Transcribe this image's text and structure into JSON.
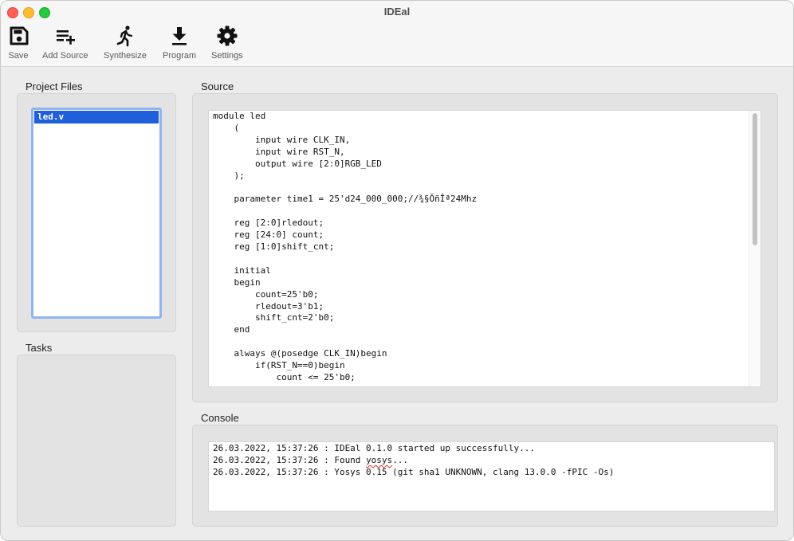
{
  "window": {
    "title": "IDEal"
  },
  "toolbar": {
    "buttons": [
      {
        "label": "Save",
        "icon": "save-icon"
      },
      {
        "label": "Add Source",
        "icon": "add-source-icon"
      },
      {
        "label": "Synthesize",
        "icon": "run-icon"
      },
      {
        "label": "Program",
        "icon": "download-icon"
      },
      {
        "label": "Settings",
        "icon": "gear-icon"
      }
    ]
  },
  "project_files": {
    "label": "Project Files",
    "items": [
      "led.v"
    ],
    "selected": "led.v"
  },
  "tasks": {
    "label": "Tasks"
  },
  "source": {
    "label": "Source",
    "code": "module led\n    (\n        input wire CLK_IN,\n        input wire RST_N,\n        output wire [2:0]RGB_LED\n    );\n\n    parameter time1 = 25'd24_000_000;//¾§ÕñÎª24Mhz\n\n    reg [2:0]rledout;\n    reg [24:0] count;\n    reg [1:0]shift_cnt;\n\n    initial\n    begin\n        count=25'b0;\n        rledout=3'b1;\n        shift_cnt=2'b0;\n    end\n\n    always @(posedge CLK_IN)begin\n        if(RST_N==0)begin\n            count <= 25'b0;"
  },
  "console": {
    "label": "Console",
    "lines": [
      {
        "pre": "26.03.2022, 15:37:26 : IDEal 0.1.0 started up successfully...",
        "flag": "",
        "post": ""
      },
      {
        "pre": "26.03.2022, 15:37:26 : Found ",
        "flag": "yosys",
        "post": "..."
      },
      {
        "pre": "26.03.2022, 15:37:26 : Yosys 0.15 (git sha1 UNKNOWN, clang 13.0.0 -fPIC -Os)",
        "flag": "",
        "post": ""
      }
    ]
  },
  "colors": {
    "selection": "#1f5fd9",
    "selection_border": "#8fb4ef",
    "close": "#fe5f57",
    "minimize": "#febc2e",
    "maximize": "#28c840"
  }
}
